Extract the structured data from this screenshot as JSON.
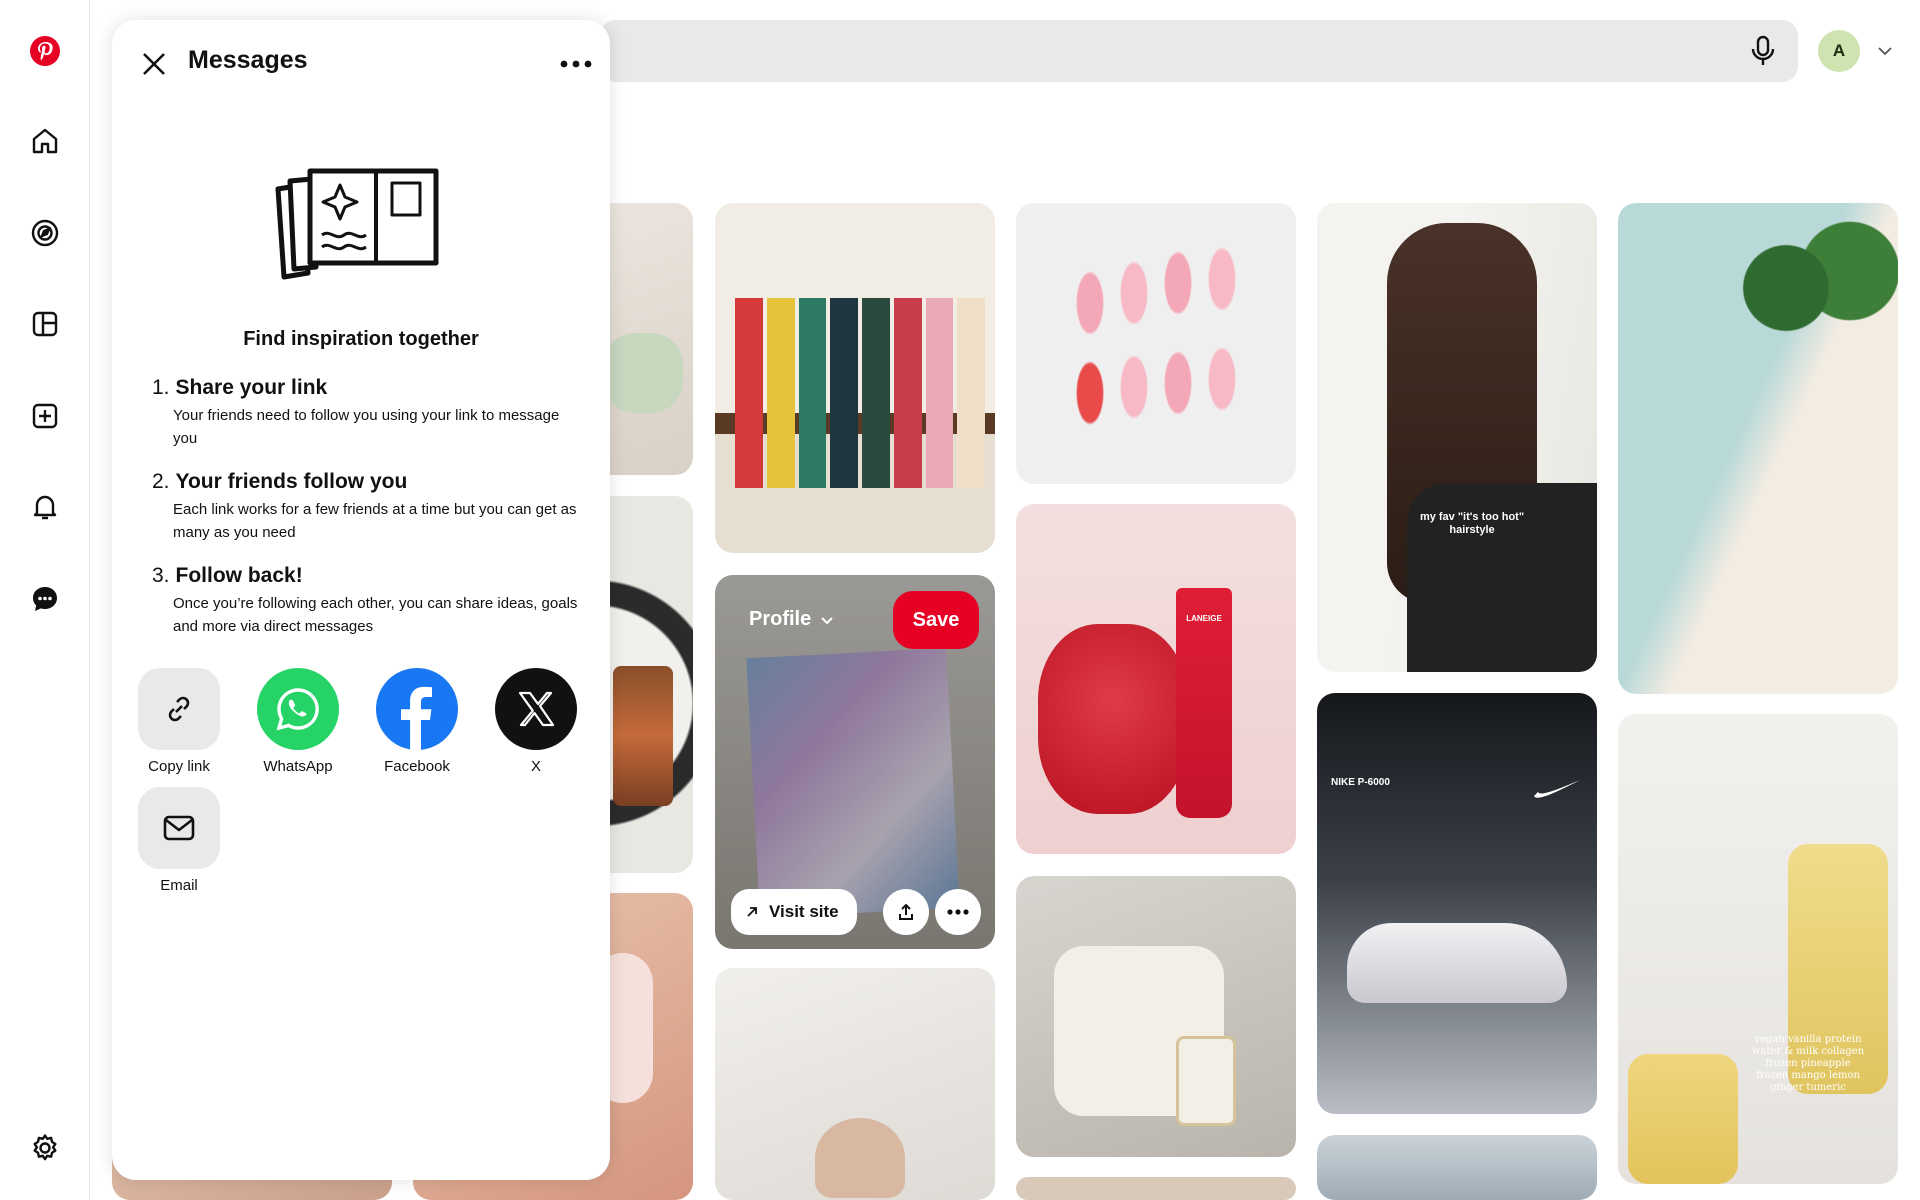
{
  "rail": {
    "items": [
      "pinterest-logo",
      "home",
      "explore",
      "boards",
      "create",
      "notifications",
      "messages",
      "settings"
    ]
  },
  "header": {
    "avatar_initial": "A"
  },
  "messages_panel": {
    "title": "Messages",
    "heading": "Find inspiration together",
    "steps": [
      {
        "num": "1.",
        "title": "Share your link",
        "body": "Your friends need to follow you using your link to message you"
      },
      {
        "num": "2.",
        "title": "Your friends follow you",
        "body": "Each link works for a few friends at a time but you can get as many as you need"
      },
      {
        "num": "3.",
        "title": "Follow back!",
        "body": "Once you’re following each other, you can share ideas, goals and more via direct messages"
      }
    ],
    "share_options": [
      {
        "label": "Copy link",
        "icon": "link-icon"
      },
      {
        "label": "WhatsApp",
        "icon": "whatsapp-icon"
      },
      {
        "label": "Facebook",
        "icon": "facebook-icon"
      },
      {
        "label": "X",
        "icon": "x-icon"
      },
      {
        "label": "Email",
        "icon": "mail-icon"
      }
    ]
  },
  "hover_pin": {
    "board_select": "Profile",
    "save_label": "Save",
    "visit_label": "Visit site"
  },
  "pins": {
    "hairstyle_caption": "my fav \"it's too hot\" hairstyle",
    "nike_caption": "NIKE P-6000",
    "smoothie_caption": "vegan vanilla protein water & milk collagen frozen pineapple frozen mango lemon ginger tumeric",
    "laneige_brand": "LANEIGE"
  },
  "colors": {
    "brand_red": "#e60023",
    "whatsapp": "#25d366",
    "facebook": "#1877f2",
    "x": "#111111"
  }
}
